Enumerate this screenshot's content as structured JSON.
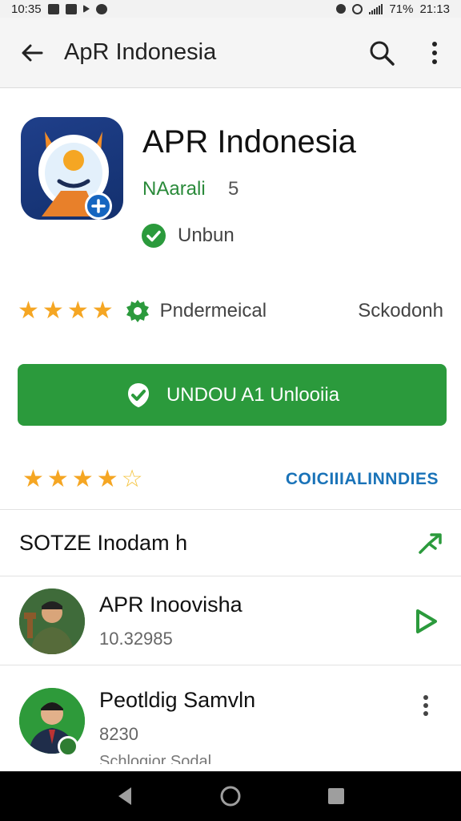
{
  "status_bar": {
    "time": "10:35",
    "battery": "71%",
    "clock_right": "21:13",
    "icons": [
      "mail-icon",
      "image-icon",
      "location-icon",
      "android-icon",
      "vibrate-icon",
      "alarm-icon",
      "signal-icon"
    ]
  },
  "app_bar": {
    "title": "ApR Indonesia",
    "back_icon": "back-arrow-icon",
    "search_icon": "search-icon",
    "menu_icon": "more-vert-icon"
  },
  "app": {
    "name": "APR Indonesia",
    "developer": "NAarali",
    "developer_count": "5",
    "verified_label": "Unbun"
  },
  "info": {
    "rating_stars": 4,
    "badge_label": "Pndermeical",
    "right_label": "Sckodonh"
  },
  "install": {
    "label": "UNDOU A1 Unlooiia"
  },
  "rating_row": {
    "full_stars": 4,
    "half_stars": 1,
    "link_label": "COICIIIALINNDIES"
  },
  "section": {
    "title": "SOTZE Inodam h"
  },
  "list": [
    {
      "title": "APR Inoovisha",
      "subtitle": "10.32985"
    },
    {
      "title": "Peotldig Samvln",
      "subtitle": "8230",
      "extra": "Schlogior Sodal"
    }
  ],
  "colors": {
    "primary_green": "#2b9a3c",
    "link_blue": "#1a73b8",
    "star_yellow": "#f5a623",
    "app_icon_navy": "#13306e"
  }
}
